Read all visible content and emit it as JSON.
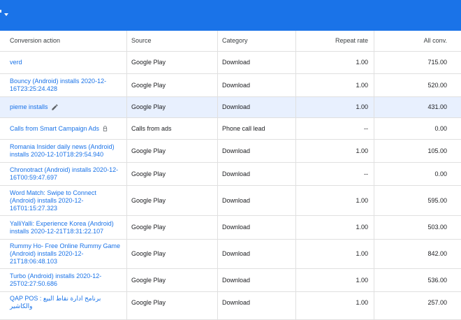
{
  "table": {
    "headers": {
      "conversion_action": "Conversion action",
      "source": "Source",
      "category": "Category",
      "repeat_rate": "Repeat rate",
      "all_conv": "All conv."
    },
    "rows": [
      {
        "name": "verd",
        "source": "Google Play",
        "category": "Download",
        "repeat_rate": "1.00",
        "all_conv": "715.00"
      },
      {
        "name": "Bouncy (Android) installs 2020-12-16T23:25:24.428",
        "source": "Google Play",
        "category": "Download",
        "repeat_rate": "1.00",
        "all_conv": "520.00"
      },
      {
        "name": "pieme installs",
        "source": "Google Play",
        "category": "Download",
        "repeat_rate": "1.00",
        "all_conv": "431.00"
      },
      {
        "name": "Calls from Smart Campaign Ads",
        "source": "Calls from ads",
        "category": "Phone call lead",
        "repeat_rate": "--",
        "all_conv": "0.00"
      },
      {
        "name": "Romania Insider daily news (Android) installs 2020-12-10T18:29:54.940",
        "source": "Google Play",
        "category": "Download",
        "repeat_rate": "1.00",
        "all_conv": "105.00"
      },
      {
        "name": "Chronotract (Android) installs 2020-12-16T00:59:47.697",
        "source": "Google Play",
        "category": "Download",
        "repeat_rate": "--",
        "all_conv": "0.00"
      },
      {
        "name": "Word Match: Swipe to Connect (Android) installs 2020-12-16T01:15:27.323",
        "source": "Google Play",
        "category": "Download",
        "repeat_rate": "1.00",
        "all_conv": "595.00"
      },
      {
        "name": "YalliYalli: Experience Korea (Android) installs 2020-12-21T18:31:22.107",
        "source": "Google Play",
        "category": "Download",
        "repeat_rate": "1.00",
        "all_conv": "503.00"
      },
      {
        "name": "Rummy Ho- Free Online Rummy Game (Android) installs 2020-12-21T18:06:48.103",
        "source": "Google Play",
        "category": "Download",
        "repeat_rate": "1.00",
        "all_conv": "842.00"
      },
      {
        "name": "Turbo (Android) installs 2020-12-25T02:27:50.686",
        "source": "Google Play",
        "category": "Download",
        "repeat_rate": "1.00",
        "all_conv": "536.00"
      },
      {
        "name": "QAP POS : برنامج ادارة نقاط البيع والكاشير",
        "source": "Google Play",
        "category": "Download",
        "repeat_rate": "1.00",
        "all_conv": "257.00"
      }
    ]
  },
  "icons": {
    "edit": "pencil-icon",
    "lock": "lock-icon",
    "topbar_menu": "chevron-down-icon"
  },
  "colors": {
    "topbar": "#1a73e8",
    "link": "#1a73e8",
    "selected_row": "#e8f0fe"
  }
}
